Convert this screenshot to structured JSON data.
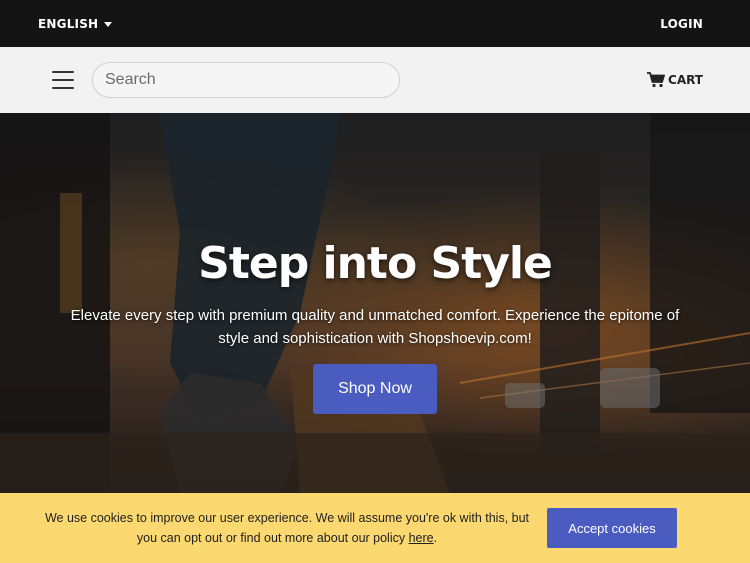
{
  "topbar": {
    "language_label": "ENGLISH",
    "login_label": "LOGIN"
  },
  "navbar": {
    "menu_icon": "hamburger-icon",
    "search_placeholder": "Search",
    "search_value": "",
    "cart_icon": "cart-icon",
    "cart_label": "CART"
  },
  "hero": {
    "title": "Step into Style",
    "subtitle": "Elevate every step with premium quality and unmatched comfort. Experience the epitome of style and sophistication with Shopshoevip.com!",
    "button_label": "Shop Now"
  },
  "cookie_banner": {
    "text_before_link": "We use cookies to improve our user experience. We will assume you're ok with this, but you can opt out or find out more about our policy ",
    "link_label": "here",
    "text_after_link": ".",
    "accept_label": "Accept cookies"
  },
  "colors": {
    "topbar_bg": "#141414",
    "navbar_bg": "#f2f2f2",
    "accent": "#4a5cc0",
    "cookie_bg": "#fbd870"
  }
}
